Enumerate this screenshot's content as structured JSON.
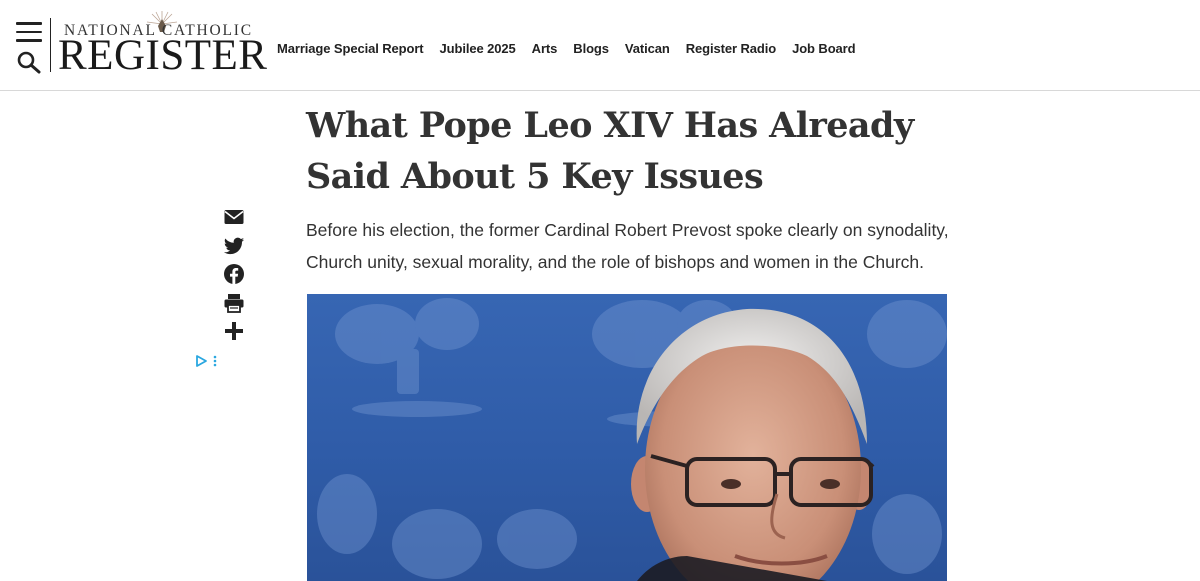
{
  "header": {
    "logo": {
      "top_text": "NATIONAL CATHOLIC",
      "main_text": "REGISTER"
    },
    "nav": [
      "Marriage Special Report",
      "Jubilee 2025",
      "Arts",
      "Blogs",
      "Vatican",
      "Register Radio",
      "Job Board"
    ]
  },
  "article": {
    "title": "What Pope Leo XIV Has Already Said About 5 Key Issues",
    "subtitle": "Before his election, the former Cardinal Robert Prevost spoke clearly on synodality, Church unity, sexual morality, and the role of bishops and women in the Church."
  },
  "share_icons": [
    "email-icon",
    "twitter-icon",
    "facebook-icon",
    "print-icon",
    "plus-icon"
  ],
  "colors": {
    "text": "#333333",
    "hero_background": "#3766b3",
    "ad_choices": "#2aa7e0"
  }
}
